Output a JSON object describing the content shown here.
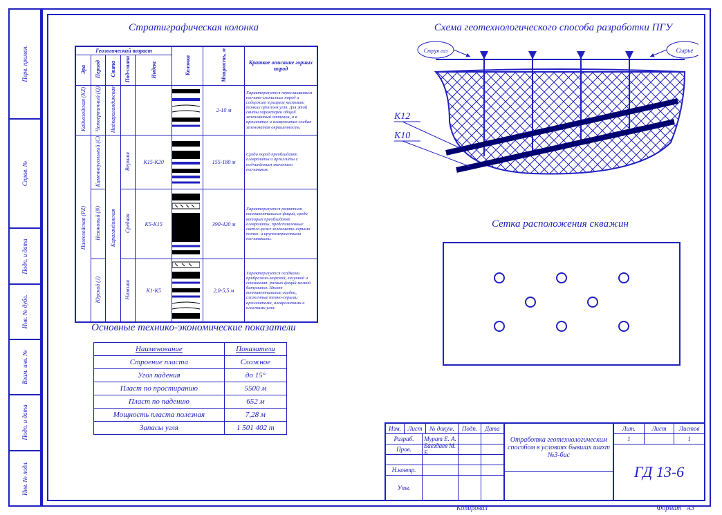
{
  "side": [
    "Перв. примен.",
    "Справ. №",
    "Подп. и дата",
    "Инв. № дубл.",
    "Взам. инв. №",
    "Подп. и дата",
    "Инв. № подл."
  ],
  "titles": {
    "strat": "Стратиграфическая колонка",
    "econ": "Основные технико-экономические показатели",
    "scheme": "Схема геотехнологического способа разработки ПГУ",
    "grid": "Сетка расположения скважин"
  },
  "strat_headers": {
    "geo": "Геологический возраст",
    "era": "Эра",
    "period": "Период",
    "svita": "Свита",
    "podsvita": "Под-свита",
    "index": "Индекс",
    "col": "Колонка",
    "thick": "Мощность, м",
    "desc": "Краткое описание горных пород"
  },
  "strat_rows": [
    {
      "era": "Кайнозойская (KZ)",
      "period": "Четвертичный (Q)",
      "svita": "Надкарагандинская",
      "pod": "",
      "idx": "",
      "thick": "2-10 м",
      "desc": "Характеризуется переслаиванием песчано-глинистых пород и содержит в разрезе несколько тонких прослоев угля. Для этой свиты характерен общий зеленоватый оттенок, а в аргиллитах и алевролитах слабая зеленоватая окрашенность."
    },
    {
      "era": "",
      "period": "Каменноугольный (C)",
      "svita": "",
      "pod": "Верхняя",
      "idx": "K15-K20",
      "thick": "155-180 м",
      "desc": "Среди пород преобладают алевролиты и аргиллиты с подчинённым значением песчаников."
    },
    {
      "era": "Палеозойская (PZ)",
      "period": "Незоновый (N)",
      "svita": "Карагандинская",
      "pod": "Средняя",
      "idx": "K5-K15",
      "thick": "390-420 м",
      "desc": "Характеризуется развитием континентальных фаций, среди которых преобладают алевролиты, представленные светло-реже зеленовато-серыми тонко- и крупнозернистыми песчаниками."
    },
    {
      "era": "",
      "period": "Юрский (J)",
      "svita": "",
      "pod": "Нижняя",
      "idx": "K1-K5",
      "thick": "2,0-5,5 м",
      "desc": "Характеризуется осадками прибрежно-морской, лагунной и сеноманит. разных фаций мелкой битуминоз. Имеет континентальные осадки, сложенные темно-серыми аргиллитами, алевролитами и пластами угля."
    }
  ],
  "econ_rows": [
    [
      "Наименование",
      "Показатели"
    ],
    [
      "Строение пласта",
      "Сложное"
    ],
    [
      "Угол падения",
      "до 15°"
    ],
    [
      "Пласт по простиранию",
      "5500 м"
    ],
    [
      "Пласт по падению",
      "652 м"
    ],
    [
      "Мощность пласта полезная",
      "7,28 м"
    ],
    [
      "Запасы угля",
      "1 501 402 т"
    ]
  ],
  "scheme": {
    "left": "Струя газ",
    "right": "Сырье",
    "k12": "К12",
    "k10": "К10"
  },
  "tblock": {
    "cols": [
      "Изм.",
      "Лист",
      "№ докум.",
      "Подп.",
      "Дата"
    ],
    "rows": [
      [
        "Разраб.",
        "Мурат Е. А."
      ],
      [
        "Пров.",
        "Баездаев М. Б."
      ],
      [
        "Н.контр.",
        ""
      ],
      [
        "Утв.",
        ""
      ]
    ],
    "title": "Отработка геотехнологическим способом в условиях бывших шахт №3-бис",
    "code": "ГД 13-6",
    "lit": "Лит.",
    "list": "Лист",
    "listov": "Листов",
    "listv": "1",
    "listovv": "1",
    "kop": "Копировал",
    "fmt_l": "Формат",
    "fmt_v": "А3"
  }
}
